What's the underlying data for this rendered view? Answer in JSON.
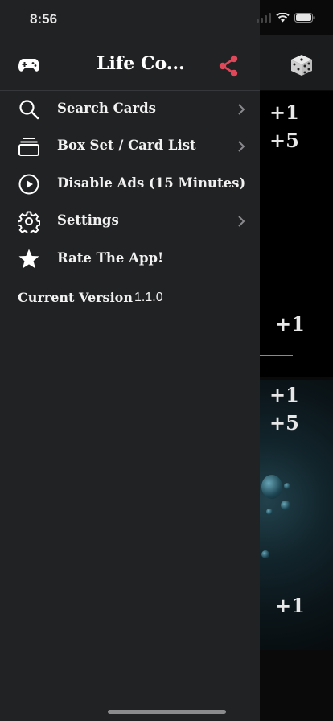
{
  "status_bar": {
    "time": "8:56"
  },
  "drawer": {
    "title": "Life Co...",
    "items": [
      {
        "label": "Search Cards",
        "icon": "search-icon",
        "has_chevron": true
      },
      {
        "label": "Box Set / Card List",
        "icon": "box-set-icon",
        "has_chevron": true
      },
      {
        "label": "Disable Ads (15 Minutes)",
        "icon": "play-circle-icon",
        "has_chevron": false
      },
      {
        "label": "Settings",
        "icon": "gear-icon",
        "has_chevron": true
      },
      {
        "label": "Rate The App!",
        "icon": "star-icon",
        "has_chevron": false
      }
    ],
    "version_label": "Current Version",
    "version_value": "1.1.0"
  },
  "counter": {
    "top_panel": {
      "plus1_top": "+1",
      "plus5": "+5",
      "plus1_bottom": "+1"
    },
    "bottom_panel": {
      "plus1_top": "+1",
      "plus5": "+5",
      "plus1_bottom": "+1"
    }
  },
  "colors": {
    "drawer_bg": "#212224",
    "share_accent": "#e0485a",
    "text": "#f2f2f2"
  }
}
